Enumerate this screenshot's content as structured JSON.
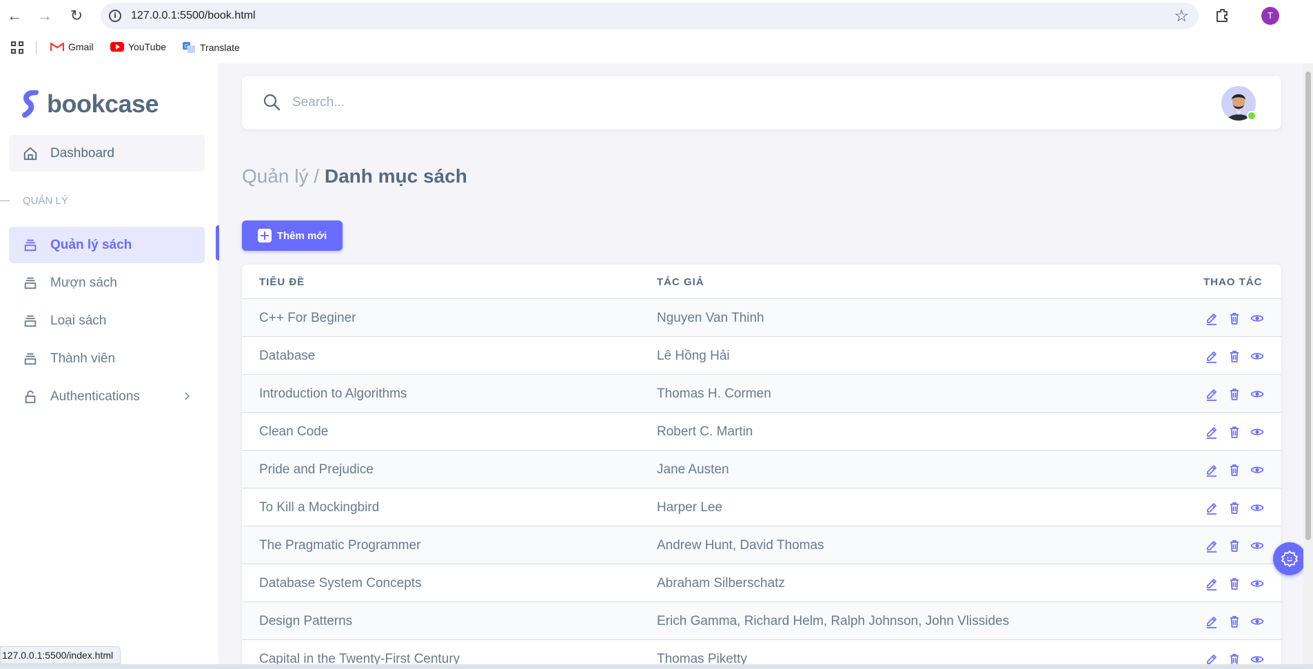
{
  "browser": {
    "url": "127.0.0.1:5500/book.html",
    "profile_initial": "T",
    "bookmarks": [
      "Gmail",
      "YouTube",
      "Translate"
    ],
    "status_url": "127.0.0.1:5500/index.html"
  },
  "brand": {
    "name": "bookcase",
    "accent": "#696cff"
  },
  "sidebar": {
    "dashboard": "Dashboard",
    "section_header": "QUẢN LÝ",
    "items": [
      {
        "label": "Quản lý sách",
        "icon": "layers-icon",
        "active": true
      },
      {
        "label": "Mượn sách",
        "icon": "layers-icon",
        "active": false
      },
      {
        "label": "Loại sách",
        "icon": "layers-icon",
        "active": false
      },
      {
        "label": "Thành viên",
        "icon": "layers-icon",
        "active": false
      },
      {
        "label": "Authentications",
        "icon": "lock-icon",
        "active": false
      }
    ]
  },
  "search": {
    "placeholder": "Search..."
  },
  "breadcrumb": {
    "parent": "Quản lý /",
    "current": "Danh mục sách"
  },
  "toolbar": {
    "add_label": "Thêm mới"
  },
  "table": {
    "headers": {
      "title": "TIÊU ĐỀ",
      "author": "TÁC GIẢ",
      "actions": "THAO TÁC"
    },
    "rows": [
      {
        "title": "C++ For Beginer",
        "author": "Nguyen Van Thinh"
      },
      {
        "title": "Database",
        "author": "Lê Hồng Hải"
      },
      {
        "title": "Introduction to Algorithms",
        "author": "Thomas H. Cormen"
      },
      {
        "title": "Clean Code",
        "author": "Robert C. Martin"
      },
      {
        "title": "Pride and Prejudice",
        "author": "Jane Austen"
      },
      {
        "title": "To Kill a Mockingbird",
        "author": "Harper Lee"
      },
      {
        "title": "The Pragmatic Programmer",
        "author": "Andrew Hunt, David Thomas"
      },
      {
        "title": "Database System Concepts",
        "author": "Abraham Silberschatz"
      },
      {
        "title": "Design Patterns",
        "author": "Erich Gamma, Richard Helm, Ralph Johnson, John Vlissides"
      },
      {
        "title": "Capital in the Twenty-First Century",
        "author": "Thomas Piketty"
      }
    ]
  }
}
